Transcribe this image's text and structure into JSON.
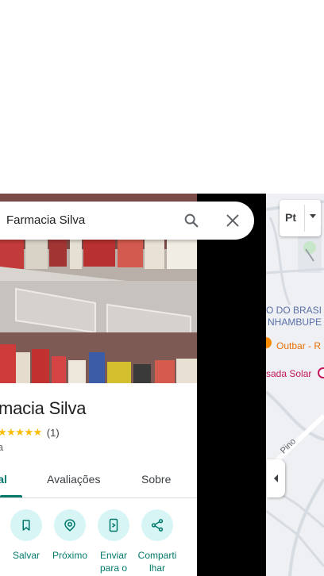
{
  "search": {
    "query": "Farmacia Silva"
  },
  "place": {
    "title": "macia Silva",
    "stars": "★★★★★",
    "rating_count": "(1)",
    "category": "ia"
  },
  "tabs": {
    "overview": "eral",
    "reviews": "Avaliações",
    "about": "Sobre"
  },
  "actions": {
    "save": "Salvar",
    "nearby": "Próximo",
    "send_line1": "Enviar",
    "send_line2": "para o",
    "share_line1": "Comparti",
    "share_line2": "lhar"
  },
  "map": {
    "label_1": "O DO BRASI",
    "label_2": "NHAMBUPE",
    "outbar": "Outbar - R",
    "solar": "sada Solar",
    "street": "Pino",
    "layer_button": "Pt"
  },
  "colors": {
    "accent": "#00796b",
    "action_bg": "#d7f5f5",
    "star": "#fbbc04"
  },
  "icons": [
    "search-icon",
    "close-icon",
    "bookmark-icon",
    "nearby-icon",
    "send-to-phone-icon",
    "share-icon",
    "chevron-left-icon",
    "layers-dropdown-icon"
  ]
}
